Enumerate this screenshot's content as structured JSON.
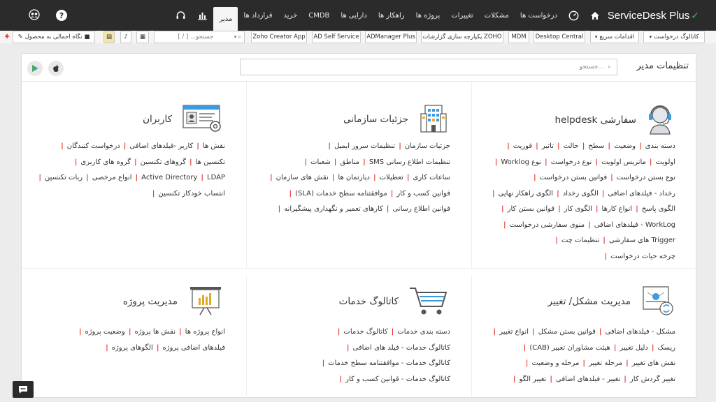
{
  "brand": {
    "name": "ServiceDesk Plus",
    "mark": "✓"
  },
  "nav": {
    "items": [
      {
        "label": "درخواست ها"
      },
      {
        "label": "مشکلات"
      },
      {
        "label": "تغییرات"
      },
      {
        "label": "پروژه ها"
      },
      {
        "label": "راهکار ها"
      },
      {
        "label": "دارایی ها"
      },
      {
        "label": "CMDB"
      },
      {
        "label": "خرید"
      },
      {
        "label": "قرارداد ها"
      },
      {
        "label": "مدیر"
      }
    ],
    "active_index": 9
  },
  "toolbar": {
    "catalog": "کاتالوگ درخواست",
    "quick": "اقدامات سریع",
    "desktop_central": "Desktop Central",
    "mdm": "MDM",
    "zoho_reports": "یکپارچه سازی گزارشات ZOHO",
    "admanager": "ADManager Plus",
    "adselfservice": "AD Self Service",
    "zoho_creator": "Zoho Creator App",
    "search_placeholder": "جستجو... [ / ]",
    "product_overview": "نگاه اجمالی به محصول"
  },
  "panel": {
    "title": "تنظیمات مدیر",
    "search_placeholder": "جستجو..."
  },
  "cells": [
    {
      "title": "helpdesk سفارشی",
      "icon": "helpdesk-headset-icon",
      "lines": [
        [
          "دسته بندی",
          "وضعیت",
          "سطح",
          "حالت",
          "تاثیر",
          "فوریت"
        ],
        [
          "اولویت",
          "ماتریس اولویت",
          "نوع درخواست",
          "نوع Worklog"
        ],
        [
          "نوع بستن درخواست",
          "قوانین بستن درخواست"
        ],
        [
          "رخداد - فیلدهای اضافی",
          "الگوی رخداد",
          "الگوی راهکار نهایی"
        ],
        [
          "الگوی پاسخ",
          "انواع کارها",
          "الگوی کار",
          "قوانین بستن کار"
        ],
        [
          "WorkLog - فیلدهای اضافی",
          "منوی سفارشی درخواست"
        ],
        [
          "Trigger های سفارشی",
          "تنظیمات چت"
        ],
        [
          "چرخه حیات درخواست"
        ]
      ]
    },
    {
      "title": "جزئیات سازمانی",
      "icon": "building-icon",
      "lines": [
        [
          "جزئیات سازمان",
          "تنظیمات سرور ایمیل"
        ],
        [
          "تنظیمات اطلاع رسانی SMS",
          "مناطق",
          "شعبات"
        ],
        [
          "ساعات کاری",
          "تعطیلات",
          "دپارتمان ها",
          "نقش های سازمان"
        ],
        [
          "قوانین کسب و کار",
          "موافقتنامه سطح خدمات (SLA)"
        ],
        [
          "قوانین اطلاع رسانی",
          "کارهای تعمیر و نگهداری پیشگیرانه"
        ]
      ]
    },
    {
      "title": "کاربران",
      "icon": "user-profile-card-icon",
      "lines": [
        [
          "نقش ها",
          "کاربر -فیلدهای اضافی",
          "درخواست کنندگان"
        ],
        [
          "تکنسین ها",
          "گروهای تکنسین",
          "گروه های کاربری"
        ],
        [
          "Active Directory",
          "LDAP",
          "انواع مرخصی",
          "ربات تکنسین"
        ],
        [
          "انتساب خودکار تکنسین"
        ]
      ]
    },
    {
      "title": "مدیریت مشکل/ تغییر",
      "icon": "problem-change-icon",
      "lines": [
        [
          "مشکل - فیلدهای اضافی",
          "قوانین بستن مشکل",
          "انواع تغییر"
        ],
        [
          "ریسک",
          "دلیل تغییر",
          "هیئت مشاوران تغییر (CAB)"
        ],
        [
          "نقش های تغییر",
          "مرحله تغییر",
          "مرحله و وضعیت"
        ],
        [
          "تغییر گردش کار",
          "تغییر - فیلدهای اضافی",
          "تغییر الگو"
        ]
      ]
    },
    {
      "title": "کاتالوگ خدمات",
      "icon": "shopping-cart-icon",
      "lines": [
        [
          "دسته بندی خدمات",
          "کاتالوگ خدمات"
        ],
        [
          "کاتالوگ خدمات - فیلد های اضافی"
        ],
        [
          "کاتالوگ خدمات - موافقتنامه سطح خدمات"
        ],
        [
          "کاتالوگ خدمات - قوانین کسب و کار"
        ]
      ]
    },
    {
      "title": "مدیریت پروژه",
      "icon": "project-board-icon",
      "lines": [
        [
          "انواع پروژه ها",
          "نقش ها پروژه",
          "وضعیت پروژه"
        ],
        [
          "فیلدهای اضافی پروژه",
          "الگوهای پروژه"
        ]
      ]
    }
  ]
}
